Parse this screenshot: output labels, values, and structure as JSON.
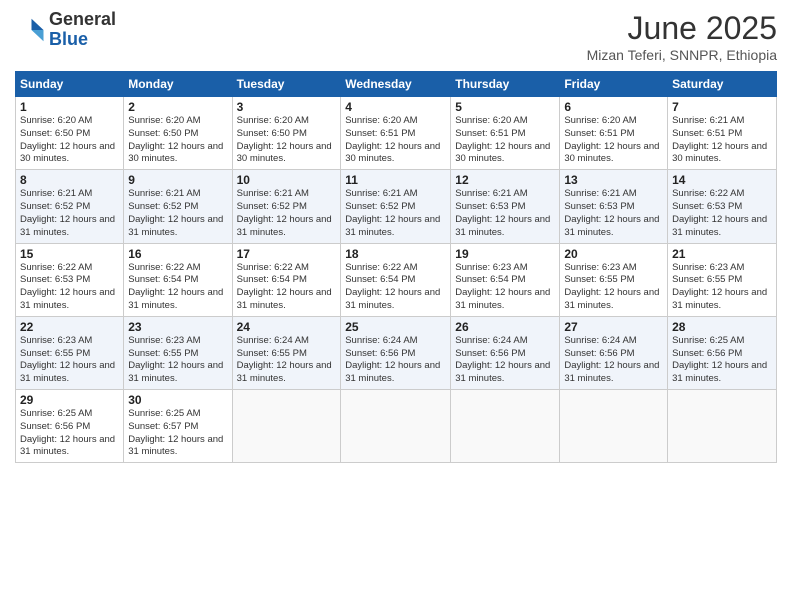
{
  "logo": {
    "general": "General",
    "blue": "Blue"
  },
  "title": "June 2025",
  "subtitle": "Mizan Teferi, SNNPR, Ethiopia",
  "days_of_week": [
    "Sunday",
    "Monday",
    "Tuesday",
    "Wednesday",
    "Thursday",
    "Friday",
    "Saturday"
  ],
  "weeks": [
    [
      {
        "day": "1",
        "sunrise": "6:20 AM",
        "sunset": "6:50 PM",
        "daylight": "12 hours and 30 minutes."
      },
      {
        "day": "2",
        "sunrise": "6:20 AM",
        "sunset": "6:50 PM",
        "daylight": "12 hours and 30 minutes."
      },
      {
        "day": "3",
        "sunrise": "6:20 AM",
        "sunset": "6:50 PM",
        "daylight": "12 hours and 30 minutes."
      },
      {
        "day": "4",
        "sunrise": "6:20 AM",
        "sunset": "6:51 PM",
        "daylight": "12 hours and 30 minutes."
      },
      {
        "day": "5",
        "sunrise": "6:20 AM",
        "sunset": "6:51 PM",
        "daylight": "12 hours and 30 minutes."
      },
      {
        "day": "6",
        "sunrise": "6:20 AM",
        "sunset": "6:51 PM",
        "daylight": "12 hours and 30 minutes."
      },
      {
        "day": "7",
        "sunrise": "6:21 AM",
        "sunset": "6:51 PM",
        "daylight": "12 hours and 30 minutes."
      }
    ],
    [
      {
        "day": "8",
        "sunrise": "6:21 AM",
        "sunset": "6:52 PM",
        "daylight": "12 hours and 31 minutes."
      },
      {
        "day": "9",
        "sunrise": "6:21 AM",
        "sunset": "6:52 PM",
        "daylight": "12 hours and 31 minutes."
      },
      {
        "day": "10",
        "sunrise": "6:21 AM",
        "sunset": "6:52 PM",
        "daylight": "12 hours and 31 minutes."
      },
      {
        "day": "11",
        "sunrise": "6:21 AM",
        "sunset": "6:52 PM",
        "daylight": "12 hours and 31 minutes."
      },
      {
        "day": "12",
        "sunrise": "6:21 AM",
        "sunset": "6:53 PM",
        "daylight": "12 hours and 31 minutes."
      },
      {
        "day": "13",
        "sunrise": "6:21 AM",
        "sunset": "6:53 PM",
        "daylight": "12 hours and 31 minutes."
      },
      {
        "day": "14",
        "sunrise": "6:22 AM",
        "sunset": "6:53 PM",
        "daylight": "12 hours and 31 minutes."
      }
    ],
    [
      {
        "day": "15",
        "sunrise": "6:22 AM",
        "sunset": "6:53 PM",
        "daylight": "12 hours and 31 minutes."
      },
      {
        "day": "16",
        "sunrise": "6:22 AM",
        "sunset": "6:54 PM",
        "daylight": "12 hours and 31 minutes."
      },
      {
        "day": "17",
        "sunrise": "6:22 AM",
        "sunset": "6:54 PM",
        "daylight": "12 hours and 31 minutes."
      },
      {
        "day": "18",
        "sunrise": "6:22 AM",
        "sunset": "6:54 PM",
        "daylight": "12 hours and 31 minutes."
      },
      {
        "day": "19",
        "sunrise": "6:23 AM",
        "sunset": "6:54 PM",
        "daylight": "12 hours and 31 minutes."
      },
      {
        "day": "20",
        "sunrise": "6:23 AM",
        "sunset": "6:55 PM",
        "daylight": "12 hours and 31 minutes."
      },
      {
        "day": "21",
        "sunrise": "6:23 AM",
        "sunset": "6:55 PM",
        "daylight": "12 hours and 31 minutes."
      }
    ],
    [
      {
        "day": "22",
        "sunrise": "6:23 AM",
        "sunset": "6:55 PM",
        "daylight": "12 hours and 31 minutes."
      },
      {
        "day": "23",
        "sunrise": "6:23 AM",
        "sunset": "6:55 PM",
        "daylight": "12 hours and 31 minutes."
      },
      {
        "day": "24",
        "sunrise": "6:24 AM",
        "sunset": "6:55 PM",
        "daylight": "12 hours and 31 minutes."
      },
      {
        "day": "25",
        "sunrise": "6:24 AM",
        "sunset": "6:56 PM",
        "daylight": "12 hours and 31 minutes."
      },
      {
        "day": "26",
        "sunrise": "6:24 AM",
        "sunset": "6:56 PM",
        "daylight": "12 hours and 31 minutes."
      },
      {
        "day": "27",
        "sunrise": "6:24 AM",
        "sunset": "6:56 PM",
        "daylight": "12 hours and 31 minutes."
      },
      {
        "day": "28",
        "sunrise": "6:25 AM",
        "sunset": "6:56 PM",
        "daylight": "12 hours and 31 minutes."
      }
    ],
    [
      {
        "day": "29",
        "sunrise": "6:25 AM",
        "sunset": "6:56 PM",
        "daylight": "12 hours and 31 minutes."
      },
      {
        "day": "30",
        "sunrise": "6:25 AM",
        "sunset": "6:57 PM",
        "daylight": "12 hours and 31 minutes."
      },
      null,
      null,
      null,
      null,
      null
    ]
  ]
}
